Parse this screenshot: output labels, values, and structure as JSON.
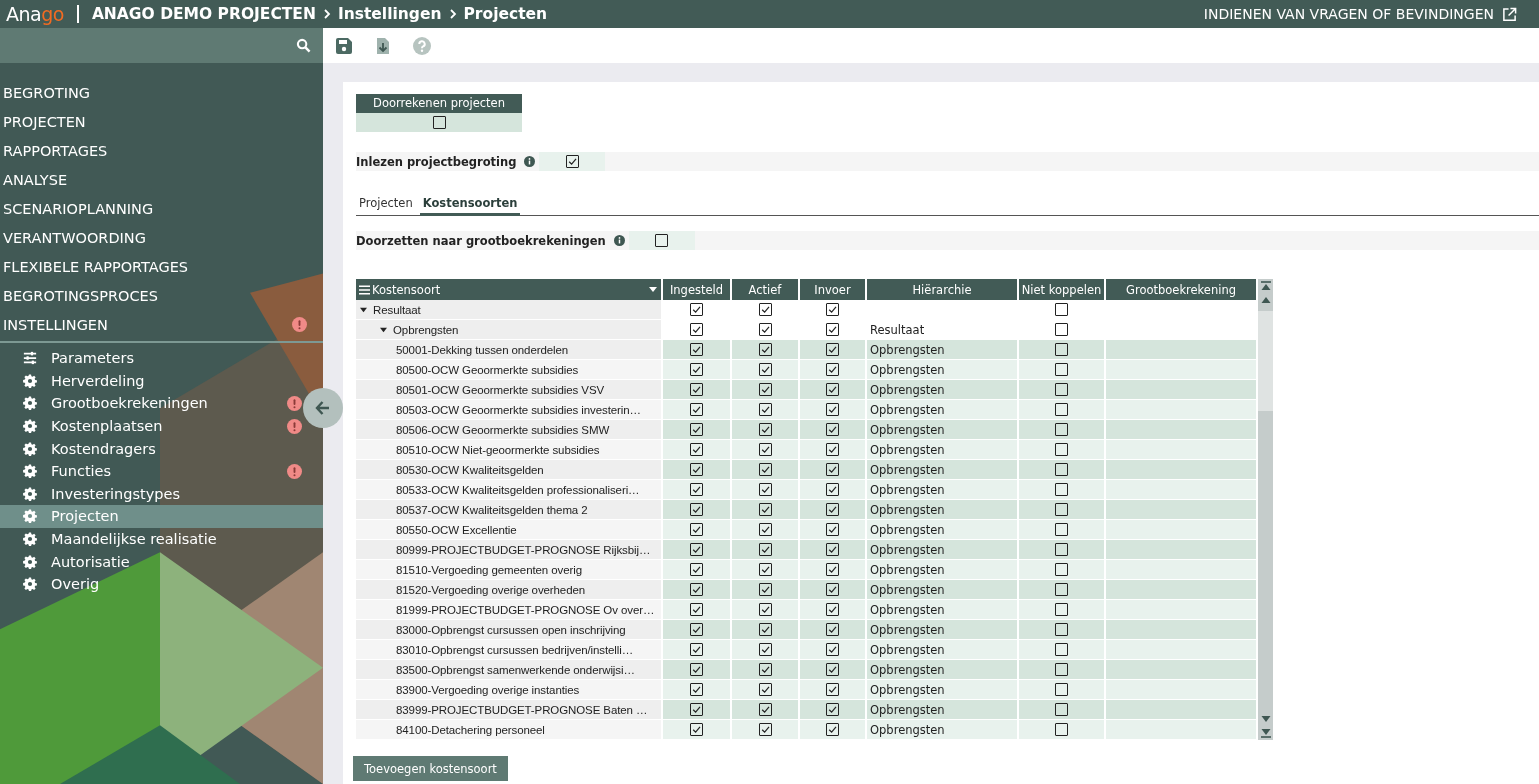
{
  "topbar": {
    "logo_start": "Ana",
    "logo_end": "go",
    "breadcrumb": [
      "ANAGO DEMO PROJECTEN",
      "Instellingen",
      "Projecten"
    ],
    "feedback_link": "INDIENEN VAN VRAGEN OF BEVINDINGEN"
  },
  "sidebar": {
    "menu": [
      {
        "label": "BEGROTING",
        "alert": false
      },
      {
        "label": "PROJECTEN",
        "alert": false
      },
      {
        "label": "RAPPORTAGES",
        "alert": false
      },
      {
        "label": "ANALYSE",
        "alert": false
      },
      {
        "label": "SCENARIOPLANNING",
        "alert": false
      },
      {
        "label": "VERANTWOORDING",
        "alert": false
      },
      {
        "label": "FLEXIBELE RAPPORTAGES",
        "alert": false
      },
      {
        "label": "BEGROTINGSPROCES",
        "alert": false
      },
      {
        "label": "INSTELLINGEN",
        "alert": true
      }
    ],
    "submenu": [
      {
        "label": "Parameters",
        "kind": "sliders",
        "alert": false,
        "selected": false
      },
      {
        "label": "Herverdeling",
        "kind": "gear",
        "alert": false,
        "selected": false
      },
      {
        "label": "Grootboekrekeningen",
        "kind": "gear",
        "alert": true,
        "selected": false
      },
      {
        "label": "Kostenplaatsen",
        "kind": "gear",
        "alert": true,
        "selected": false
      },
      {
        "label": "Kostendragers",
        "kind": "gear",
        "alert": false,
        "selected": false
      },
      {
        "label": "Functies",
        "kind": "gear",
        "alert": true,
        "selected": false
      },
      {
        "label": "Investeringstypes",
        "kind": "gear",
        "alert": false,
        "selected": false
      },
      {
        "label": "Projecten",
        "kind": "gear",
        "alert": false,
        "selected": true
      },
      {
        "label": "Maandelijkse realisatie",
        "kind": "gear",
        "alert": false,
        "selected": false
      },
      {
        "label": "Autorisatie",
        "kind": "gear",
        "alert": false,
        "selected": false
      },
      {
        "label": "Overig",
        "kind": "gear",
        "alert": false,
        "selected": false
      }
    ]
  },
  "settings": {
    "doorrekenen": {
      "label": "Doorrekenen projecten",
      "checked": false
    },
    "inlezen": {
      "label": "Inlezen projectbegroting",
      "checked": true
    }
  },
  "tabs": [
    {
      "label": "Projecten",
      "selected": false
    },
    {
      "label": "Kostensoorten",
      "selected": true
    }
  ],
  "doorzetten": {
    "label": "Doorzetten naar grootboekrekeningen",
    "checked": false
  },
  "table": {
    "columns": [
      "Kostensoort",
      "Ingesteld",
      "Actief",
      "Invoer",
      "Hiërarchie",
      "Niet koppelen",
      "Grootboekrekening"
    ],
    "rows": [
      {
        "name": "Resultaat",
        "ingesteld": true,
        "actief": true,
        "invoer": true,
        "niet_koppelen": false,
        "expanded": true,
        "children": [
          {
            "name": "Opbrengsten",
            "ingesteld": true,
            "actief": true,
            "invoer": true,
            "hierarchy": "Resultaat",
            "niet_koppelen": false,
            "expanded": true,
            "children": [
              {
                "name": "50001-Dekking tussen onderdelen",
                "ingesteld": true,
                "actief": true,
                "invoer": true,
                "hierarchy": "Opbrengsten",
                "niet_koppelen": false
              },
              {
                "name": "80500-OCW Geoormerkte subsidies",
                "ingesteld": true,
                "actief": true,
                "invoer": true,
                "hierarchy": "Opbrengsten",
                "niet_koppelen": false
              },
              {
                "name": "80501-OCW Geoormerkte subsidies VSV",
                "ingesteld": true,
                "actief": true,
                "invoer": true,
                "hierarchy": "Opbrengsten",
                "niet_koppelen": false
              },
              {
                "name": "80503-OCW Geoormerkte subsidies investerin…",
                "ingesteld": true,
                "actief": true,
                "invoer": true,
                "hierarchy": "Opbrengsten",
                "niet_koppelen": false
              },
              {
                "name": "80506-OCW Geoormerkte subsidies SMW",
                "ingesteld": true,
                "actief": true,
                "invoer": true,
                "hierarchy": "Opbrengsten",
                "niet_koppelen": false
              },
              {
                "name": "80510-OCW Niet-geoormerkte subsidies",
                "ingesteld": true,
                "actief": true,
                "invoer": true,
                "hierarchy": "Opbrengsten",
                "niet_koppelen": false
              },
              {
                "name": "80530-OCW Kwaliteitsgelden",
                "ingesteld": true,
                "actief": true,
                "invoer": true,
                "hierarchy": "Opbrengsten",
                "niet_koppelen": false
              },
              {
                "name": "80533-OCW Kwaliteitsgelden professionaliseri…",
                "ingesteld": true,
                "actief": true,
                "invoer": true,
                "hierarchy": "Opbrengsten",
                "niet_koppelen": false
              },
              {
                "name": "80537-OCW Kwaliteitsgelden thema 2",
                "ingesteld": true,
                "actief": true,
                "invoer": true,
                "hierarchy": "Opbrengsten",
                "niet_koppelen": false
              },
              {
                "name": "80550-OCW Excellentie",
                "ingesteld": true,
                "actief": true,
                "invoer": true,
                "hierarchy": "Opbrengsten",
                "niet_koppelen": false
              },
              {
                "name": "80999-PROJECTBUDGET-PROGNOSE Rijksbij…",
                "ingesteld": true,
                "actief": true,
                "invoer": true,
                "hierarchy": "Opbrengsten",
                "niet_koppelen": false
              },
              {
                "name": "81510-Vergoeding gemeenten overig",
                "ingesteld": true,
                "actief": true,
                "invoer": true,
                "hierarchy": "Opbrengsten",
                "niet_koppelen": false
              },
              {
                "name": "81520-Vergoeding overige overheden",
                "ingesteld": true,
                "actief": true,
                "invoer": true,
                "hierarchy": "Opbrengsten",
                "niet_koppelen": false
              },
              {
                "name": "81999-PROJECTBUDGET-PROGNOSE Ov over…",
                "ingesteld": true,
                "actief": true,
                "invoer": true,
                "hierarchy": "Opbrengsten",
                "niet_koppelen": false
              },
              {
                "name": "83000-Opbrengst cursussen open inschrijving",
                "ingesteld": true,
                "actief": true,
                "invoer": true,
                "hierarchy": "Opbrengsten",
                "niet_koppelen": false
              },
              {
                "name": "83010-Opbrengst cursussen bedrijven/instelli…",
                "ingesteld": true,
                "actief": true,
                "invoer": true,
                "hierarchy": "Opbrengsten",
                "niet_koppelen": false
              },
              {
                "name": "83500-Opbrengst samenwerkende onderwijsi…",
                "ingesteld": true,
                "actief": true,
                "invoer": true,
                "hierarchy": "Opbrengsten",
                "niet_koppelen": false
              },
              {
                "name": "83900-Vergoeding overige instanties",
                "ingesteld": true,
                "actief": true,
                "invoer": true,
                "hierarchy": "Opbrengsten",
                "niet_koppelen": false
              },
              {
                "name": "83999-PROJECTBUDGET-PROGNOSE Baten …",
                "ingesteld": true,
                "actief": true,
                "invoer": true,
                "hierarchy": "Opbrengsten",
                "niet_koppelen": false
              },
              {
                "name": "84100-Detachering personeel",
                "ingesteld": true,
                "actief": true,
                "invoer": true,
                "hierarchy": "Opbrengsten",
                "niet_koppelen": false
              }
            ]
          }
        ]
      }
    ]
  },
  "add_button": "Toevoegen kostensoort"
}
